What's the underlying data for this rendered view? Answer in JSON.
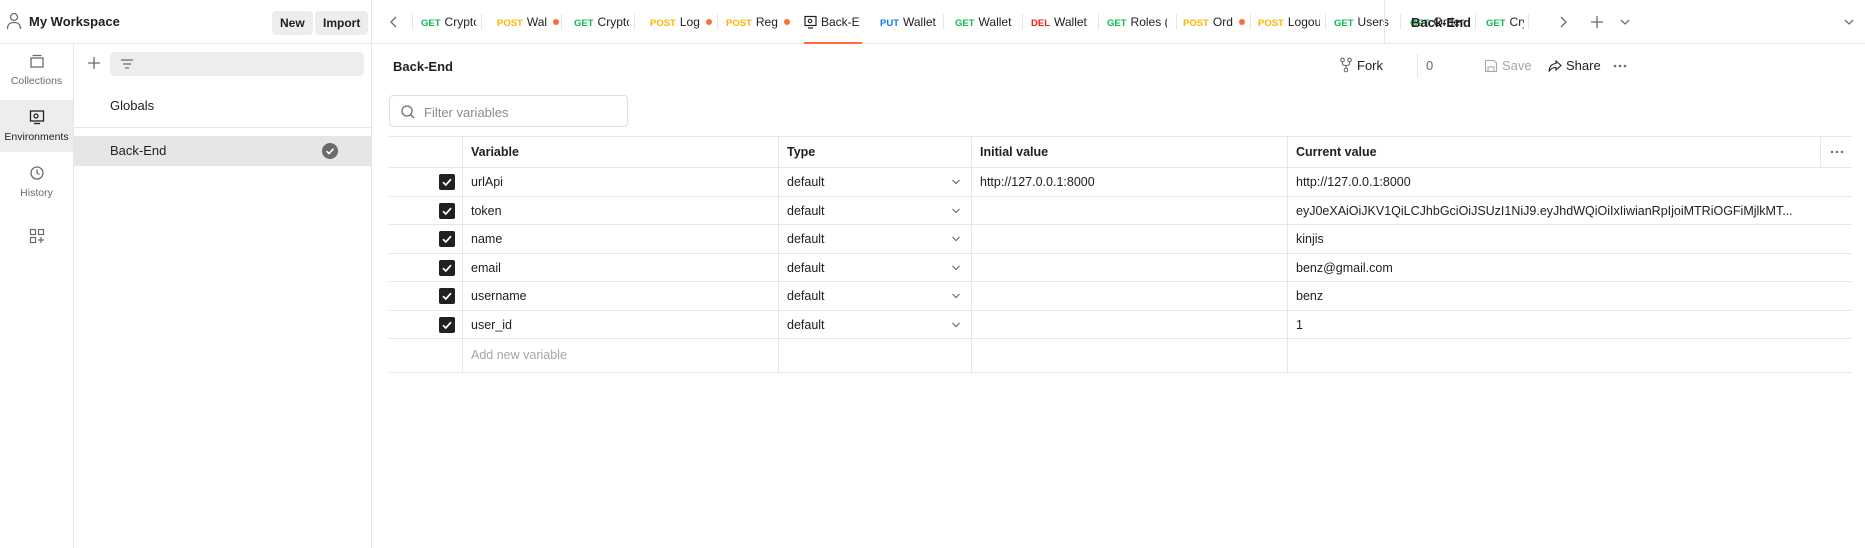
{
  "workspace": {
    "title": "My Workspace",
    "new_label": "New",
    "import_label": "Import"
  },
  "rail": [
    {
      "label": "Collections",
      "icon": "collections-icon"
    },
    {
      "label": "Environments",
      "icon": "environments-icon"
    },
    {
      "label": "History",
      "icon": "history-icon"
    },
    {
      "label": "",
      "icon": "add-apps-icon"
    }
  ],
  "env_list": {
    "globals": "Globals",
    "active_env": "Back-End"
  },
  "tabs": [
    {
      "method": "GET",
      "name": "Crypto",
      "dot": false
    },
    {
      "method": "POST",
      "name": "Wal",
      "dot": true
    },
    {
      "method": "GET",
      "name": "Crypto",
      "dot": false
    },
    {
      "method": "POST",
      "name": "Log",
      "dot": true
    },
    {
      "method": "POST",
      "name": "Reg",
      "dot": true
    },
    {
      "method": "",
      "name": "Back-E",
      "dot": false,
      "active": true
    },
    {
      "method": "PUT",
      "name": "Wallet",
      "dot": false
    },
    {
      "method": "GET",
      "name": "Wallet",
      "dot": false
    },
    {
      "method": "DEL",
      "name": "Wallet",
      "dot": false
    },
    {
      "method": "GET",
      "name": "Roles (",
      "dot": false
    },
    {
      "method": "POST",
      "name": "Ord",
      "dot": true
    },
    {
      "method": "POST",
      "name": "Logou",
      "dot": false
    },
    {
      "method": "GET",
      "name": "Users",
      "dot": false
    },
    {
      "method": "GET",
      "name": "Order",
      "dot": false
    },
    {
      "method": "GET",
      "name": "Cryp",
      "dot": false
    }
  ],
  "environment_selector": {
    "value": "Back-End"
  },
  "main": {
    "title": "Back-End",
    "fork_label": "Fork",
    "fork_count": "0",
    "save_label": "Save",
    "share_label": "Share",
    "filter_placeholder": "Filter variables"
  },
  "table": {
    "headers": {
      "variable": "Variable",
      "type": "Type",
      "initial": "Initial value",
      "current": "Current value"
    },
    "rows": [
      {
        "checked": true,
        "variable": "urlApi",
        "type": "default",
        "initial": "http://127.0.0.1:8000",
        "current": "http://127.0.0.1:8000"
      },
      {
        "checked": true,
        "variable": "token",
        "type": "default",
        "initial": "",
        "current": "eyJ0eXAiOiJKV1QiLCJhbGciOiJSUzI1NiJ9.eyJhdWQiOiIxIiwianRpIjoiMTRiOGFiMjlkMT..."
      },
      {
        "checked": true,
        "variable": "name",
        "type": "default",
        "initial": "",
        "current": "kinjis"
      },
      {
        "checked": true,
        "variable": "email",
        "type": "default",
        "initial": "",
        "current": "benz@gmail.com"
      },
      {
        "checked": true,
        "variable": "username",
        "type": "default",
        "initial": "",
        "current": "benz"
      },
      {
        "checked": true,
        "variable": "user_id",
        "type": "default",
        "initial": "",
        "current": "1"
      }
    ],
    "add_placeholder": "Add new variable"
  }
}
